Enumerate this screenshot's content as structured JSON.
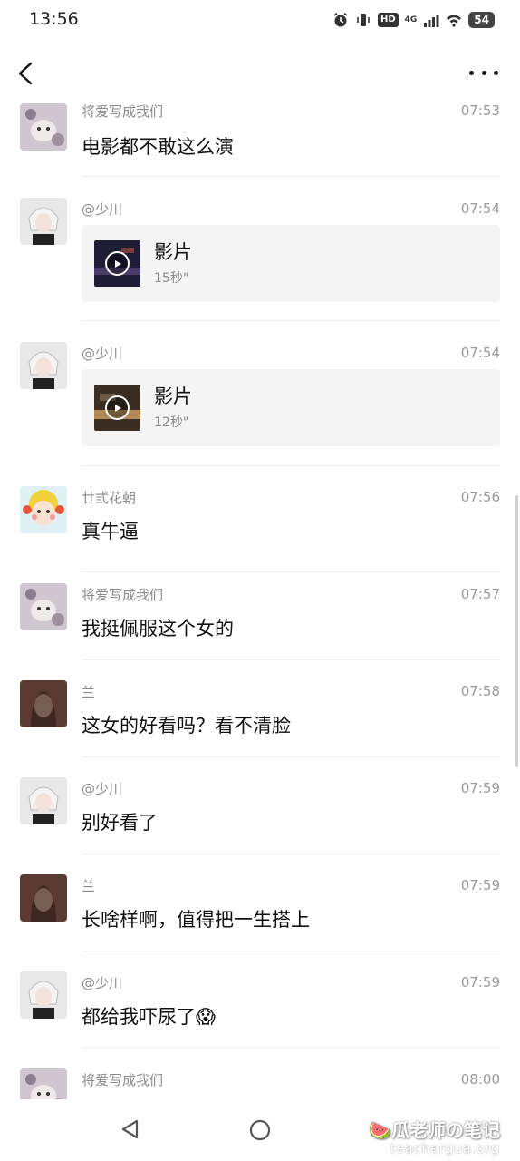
{
  "status_bar": {
    "time": "13:56",
    "hd": "HD",
    "network": "4G",
    "battery": "54"
  },
  "colors": {
    "background": "#ffffff",
    "meta_text": "#8a8a8a",
    "card_bg": "#f4f4f4",
    "divider": "#eeeeee"
  },
  "messages": [
    {
      "sender": "将爱写成我们",
      "time": "07:53",
      "text": "电影都不敢这么演",
      "avatar": "cat-avatar"
    },
    {
      "sender": "@少川",
      "time": "07:54",
      "video_title": "影片",
      "video_duration": "15秒\"",
      "avatar": "anime-boy-avatar"
    },
    {
      "sender": "@少川",
      "time": "07:54",
      "video_title": "影片",
      "video_duration": "12秒\"",
      "avatar": "anime-boy-avatar"
    },
    {
      "sender": "廿弎花朝",
      "time": "07:56",
      "text": "真牛逼",
      "avatar": "cartoon-girl-avatar"
    },
    {
      "sender": "将爱写成我们",
      "time": "07:57",
      "text": "我挺佩服这个女的",
      "avatar": "cat-avatar"
    },
    {
      "sender": "兰",
      "time": "07:58",
      "text": "这女的好看吗？看不清脸",
      "avatar": "woman-avatar"
    },
    {
      "sender": "@少川",
      "time": "07:59",
      "text": "别好看了",
      "avatar": "anime-boy-avatar"
    },
    {
      "sender": "兰",
      "time": "07:59",
      "text": "长啥样啊，值得把一生搭上",
      "avatar": "woman-avatar"
    },
    {
      "sender": "@少川",
      "time": "07:59",
      "text": "都给我吓尿了😱",
      "avatar": "anime-boy-avatar"
    },
    {
      "sender": "将爱写成我们",
      "time": "08:00",
      "text": "",
      "avatar": "cat-avatar"
    }
  ],
  "watermark": {
    "line1": "瓜老师の笔记",
    "line2": "teachergua.org"
  }
}
